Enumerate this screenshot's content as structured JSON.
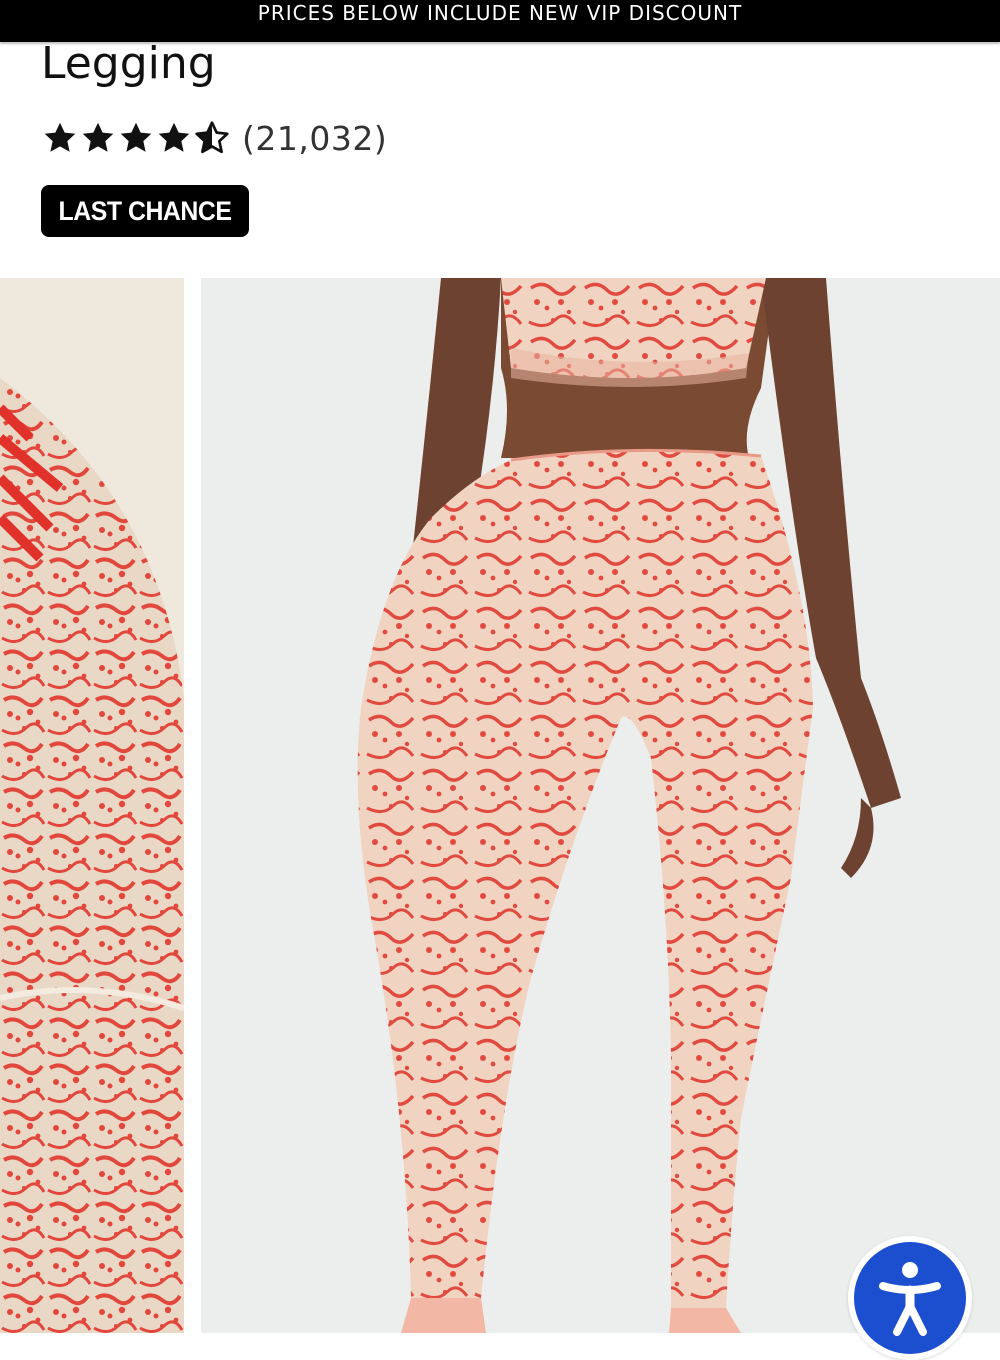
{
  "promo": {
    "text": "PRICES BELOW INCLUDE NEW VIP DISCOUNT"
  },
  "product": {
    "title": "Legging",
    "rating": 4.5,
    "review_count": "(21,032)",
    "badge": "LAST CHANCE"
  },
  "colors": {
    "accent": "#000000",
    "print_red": "#e2473c",
    "print_base": "#efd5c2",
    "accessibility_blue": "#1c4fcf"
  },
  "icons": {
    "star": "star-icon",
    "half_star": "star-half-icon",
    "accessibility": "accessibility-icon"
  }
}
